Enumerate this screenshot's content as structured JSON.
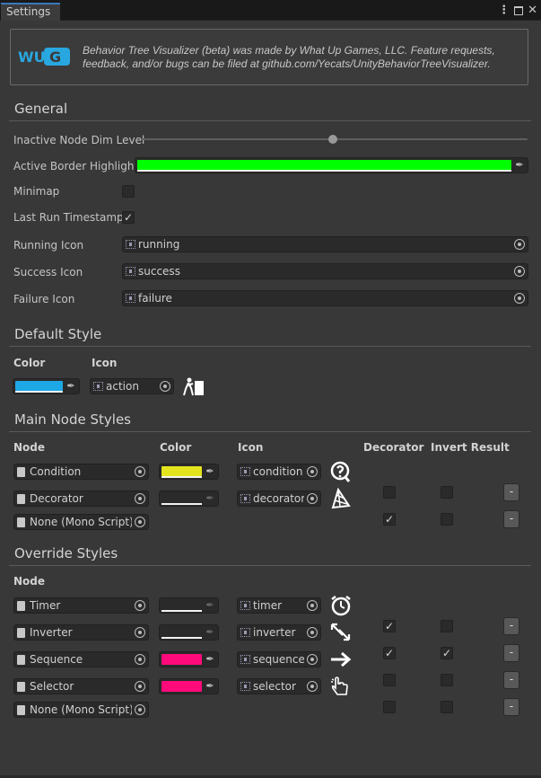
{
  "window": {
    "tab_title": "Settings",
    "menu_icon": "kebab-menu-icon",
    "maximize_icon": "maximize-icon",
    "close_icon": "close-icon"
  },
  "info": {
    "logo_text": "WUG",
    "text": "Behavior Tree Visualizer (beta) was made by What Up Games, LLC.  Feature requests, feedback, and/or bugs can be filed at github.com/Yecats/UnityBehaviorTreeVisualizer."
  },
  "general": {
    "header": "General",
    "dim_label": "Inactive Node Dim Level",
    "dim_level": 0.5,
    "border_label": "Active Border Highlight",
    "border_color": "#00ff00",
    "minimap_label": "Minimap",
    "minimap_checked": false,
    "timestamp_label": "Last Run Timestamp",
    "timestamp_checked": true,
    "running_label": "Running Icon",
    "running_value": "running",
    "success_label": "Success Icon",
    "success_value": "success",
    "failure_label": "Failure Icon",
    "failure_value": "failure"
  },
  "default_style": {
    "header": "Default Style",
    "color_label": "Color",
    "icon_label": "Icon",
    "color": "#1ea8e6",
    "icon_value": "action"
  },
  "main_styles": {
    "header": "Main Node Styles",
    "col_node": "Node",
    "col_color": "Color",
    "col_icon": "Icon",
    "col_decorator": "Decorator",
    "col_invert": "Invert Result",
    "rows": [
      {
        "node": "Condition",
        "color": "#e4e41e",
        "icon": "condition",
        "decorator": false,
        "invert": false,
        "remove": "-"
      },
      {
        "node": "Decorator",
        "color": "#2a2a2a",
        "icon": "decorator",
        "decorator": true,
        "invert": false,
        "remove": "-"
      }
    ],
    "empty_slot": "None (Mono Script)"
  },
  "override_styles": {
    "header": "Override Styles",
    "col_node": "Node",
    "rows": [
      {
        "node": "Timer",
        "color": "#2a2a2a",
        "icon": "timer",
        "decorator": true,
        "invert": false,
        "remove": "-"
      },
      {
        "node": "Inverter",
        "color": "#2a2a2a",
        "icon": "inverter",
        "decorator": true,
        "invert": true,
        "remove": "-"
      },
      {
        "node": "Sequence",
        "color": "#ff0a7a",
        "icon": "sequencer",
        "decorator": false,
        "invert": false,
        "remove": "-"
      },
      {
        "node": "Selector",
        "color": "#ff0a7a",
        "icon": "selector",
        "decorator": false,
        "invert": false,
        "remove": "-"
      }
    ],
    "empty_slot": "None (Mono Script)"
  },
  "colors": {
    "accent": "#3a79bb",
    "background": "#383838",
    "field": "#2a2a2a"
  }
}
